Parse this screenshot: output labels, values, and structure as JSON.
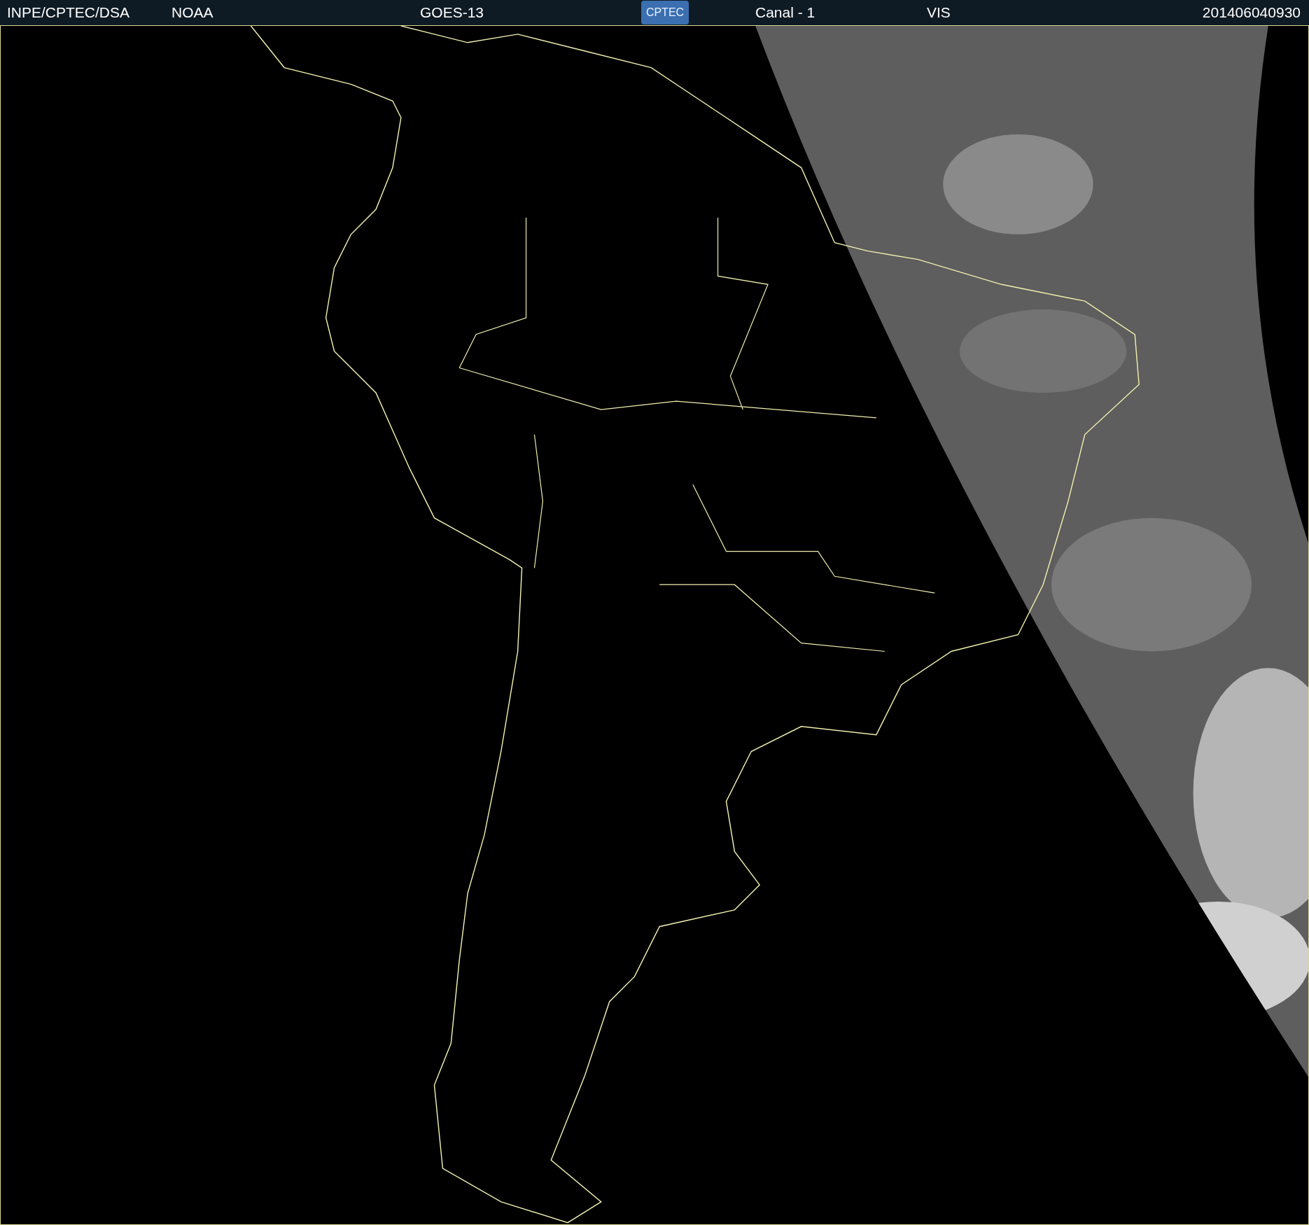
{
  "header": {
    "source": "INPE/CPTEC/DSA",
    "agency": "NOAA",
    "satellite": "GOES-13",
    "logo": "CPTEC",
    "channel": "Canal - 1",
    "band": "VIS",
    "timestamp": "201406040930"
  }
}
